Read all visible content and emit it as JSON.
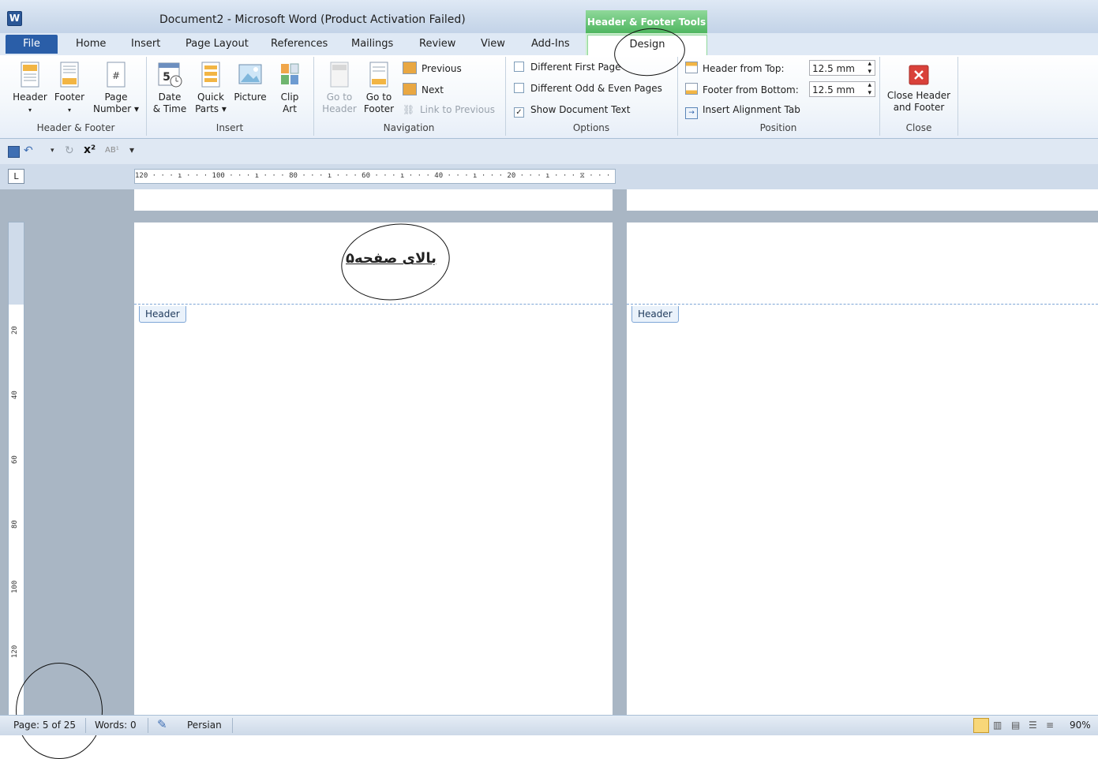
{
  "app": {
    "icon_letter": "W",
    "title": "Document2 - Microsoft Word (Product Activation Failed)",
    "context_title": "Header & Footer Tools"
  },
  "tabs": {
    "file": "File",
    "home": "Home",
    "insert": "Insert",
    "page_layout": "Page Layout",
    "references": "References",
    "mailings": "Mailings",
    "review": "Review",
    "view": "View",
    "addins": "Add-Ins",
    "design": "Design"
  },
  "ribbon": {
    "header_footer": {
      "label": "Header & Footer",
      "header": "Header",
      "footer": "Footer",
      "page_number_1": "Page",
      "page_number_2": "Number"
    },
    "insert": {
      "label": "Insert",
      "date_time_1": "Date",
      "date_time_2": "& Time",
      "quick_parts_1": "Quick",
      "quick_parts_2": "Parts",
      "picture": "Picture",
      "clip_art_1": "Clip",
      "clip_art_2": "Art"
    },
    "navigation": {
      "label": "Navigation",
      "goto_header_1": "Go to",
      "goto_header_2": "Header",
      "goto_footer_1": "Go to",
      "goto_footer_2": "Footer",
      "previous": "Previous",
      "next": "Next",
      "link_to_previous": "Link to Previous"
    },
    "options": {
      "label": "Options",
      "different_first_page": "Different First Page",
      "different_odd_even": "Different Odd & Even Pages",
      "show_document_text": "Show Document Text",
      "show_document_text_checked": true
    },
    "position": {
      "label": "Position",
      "header_from_top": "Header from Top:",
      "header_from_top_value": "12.5 mm",
      "footer_from_bottom": "Footer from Bottom:",
      "footer_from_bottom_value": "12.5 mm",
      "insert_alignment_tab": "Insert Alignment Tab"
    },
    "close": {
      "label": "Close",
      "close_1": "Close Header",
      "close_2": "and Footer"
    }
  },
  "ruler": {
    "horizontal": "120 · · · ı · · · 100 · · · ı · · · 80 · · · ı · · · 60 · · · ı · · · 40 · · · ı · · · 20 · · · ı · · · ⧖ · · · ı · · · 20 · ·",
    "vertical_ticks": [
      "20",
      "40",
      "60",
      "80",
      "100",
      "120"
    ]
  },
  "document": {
    "header_text": "بالای صفحه۵",
    "header_tag_left": "Header",
    "header_tag_right": "Header"
  },
  "status": {
    "page": "Page: 5 of 25",
    "words": "Words: 0",
    "language": "Persian",
    "zoom": "90%"
  }
}
